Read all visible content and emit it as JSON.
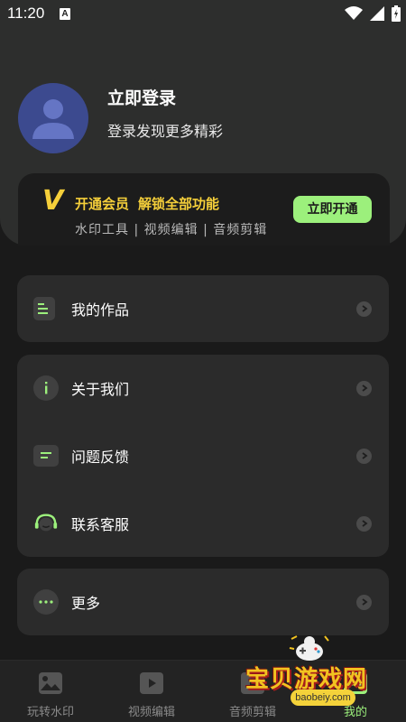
{
  "status_bar": {
    "time": "11:20",
    "badge": "A"
  },
  "profile": {
    "title": "立即登录",
    "subtitle": "登录发现更多精彩"
  },
  "vip": {
    "logo": "V",
    "title_1": "开通会员",
    "title_2": "解锁全部功能",
    "subtitle": "水印工具 | 视频编辑 | 音频剪辑",
    "button": "立即开通",
    "accent_color": "#f5cf3a",
    "button_color": "#9cf07c"
  },
  "menu": {
    "works": {
      "label": "我的作品",
      "icon": "document-list-icon"
    },
    "about": {
      "label": "关于我们",
      "icon": "info-icon"
    },
    "feedback": {
      "label": "问题反馈",
      "icon": "chat-icon"
    },
    "service": {
      "label": "联系客服",
      "icon": "headset-icon"
    },
    "more": {
      "label": "更多",
      "icon": "more-dots-icon"
    }
  },
  "tabs": [
    {
      "label": "玩转水印",
      "icon": "image-watermark-icon",
      "active": false
    },
    {
      "label": "视频编辑",
      "icon": "video-play-icon",
      "active": false
    },
    {
      "label": "音频剪辑",
      "icon": "audio-icon",
      "active": false
    },
    {
      "label": "我的",
      "icon": "profile-icon",
      "active": true
    }
  ],
  "watermark": {
    "text": "宝贝游戏网",
    "url": "baobeiy.com"
  }
}
